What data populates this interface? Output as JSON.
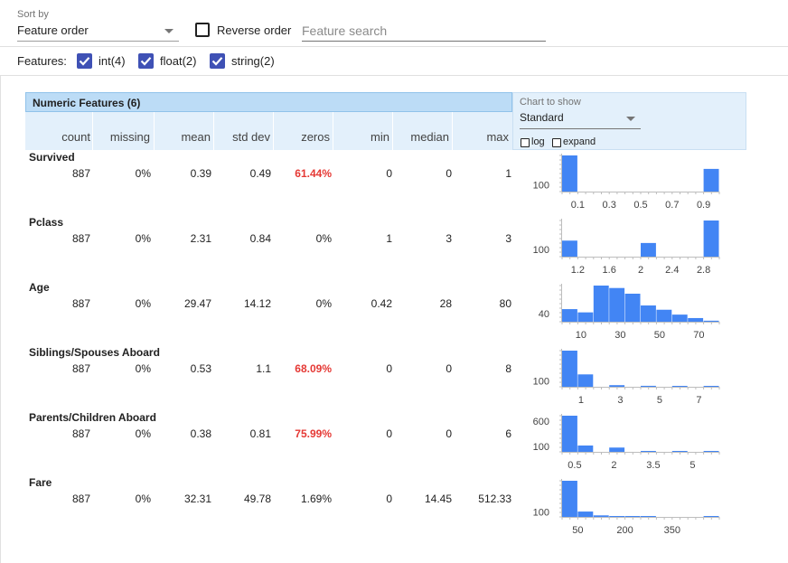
{
  "toolbar": {
    "sort_label": "Sort by",
    "sort_value": "Feature order",
    "reverse_label": "Reverse order",
    "reverse_checked": false,
    "search_placeholder": "Feature search"
  },
  "features_filter": {
    "label": "Features:",
    "items": [
      {
        "label": "int(4)",
        "checked": true
      },
      {
        "label": "float(2)",
        "checked": true
      },
      {
        "label": "string(2)",
        "checked": true
      }
    ]
  },
  "numeric_table": {
    "section_title": "Numeric Features (6)",
    "columns": [
      "count",
      "missing",
      "mean",
      "std dev",
      "zeros",
      "min",
      "median",
      "max"
    ],
    "chart_control": {
      "label": "Chart to show",
      "value": "Standard",
      "log_label": "log",
      "expand_label": "expand",
      "log_checked": false,
      "expand_checked": false
    },
    "rows": [
      {
        "name": "Survived",
        "count": "887",
        "missing": "0%",
        "mean": "0.39",
        "std_dev": "0.49",
        "zeros": "61.44%",
        "zeros_highlight": true,
        "min": "0",
        "median": "0",
        "max": "1"
      },
      {
        "name": "Pclass",
        "count": "887",
        "missing": "0%",
        "mean": "2.31",
        "std_dev": "0.84",
        "zeros": "0%",
        "zeros_highlight": false,
        "min": "1",
        "median": "3",
        "max": "3"
      },
      {
        "name": "Age",
        "count": "887",
        "missing": "0%",
        "mean": "29.47",
        "std_dev": "14.12",
        "zeros": "0%",
        "zeros_highlight": false,
        "min": "0.42",
        "median": "28",
        "max": "80"
      },
      {
        "name": "Siblings/Spouses Aboard",
        "count": "887",
        "missing": "0%",
        "mean": "0.53",
        "std_dev": "1.1",
        "zeros": "68.09%",
        "zeros_highlight": true,
        "min": "0",
        "median": "0",
        "max": "8"
      },
      {
        "name": "Parents/Children Aboard",
        "count": "887",
        "missing": "0%",
        "mean": "0.38",
        "std_dev": "0.81",
        "zeros": "75.99%",
        "zeros_highlight": true,
        "min": "0",
        "median": "0",
        "max": "6"
      },
      {
        "name": "Fare",
        "count": "887",
        "missing": "0%",
        "mean": "32.31",
        "std_dev": "49.78",
        "zeros": "1.69%",
        "zeros_highlight": false,
        "min": "0",
        "median": "14.45",
        "max": "512.33"
      }
    ]
  },
  "colors": {
    "bar": "#4285f4",
    "highlight": "#e53935",
    "checkbox": "#3f51b5",
    "header_bg": "#e3f0fb",
    "section_bg": "#bcdcf6"
  },
  "chart_data": [
    {
      "type": "bar",
      "feature": "Survived",
      "xlim": [
        0,
        1
      ],
      "x_ticks": [
        "0.1",
        "0.3",
        "0.5",
        "0.7",
        "0.9"
      ],
      "y_ticks": [
        "100"
      ],
      "values": [
        545,
        0,
        0,
        0,
        0,
        0,
        0,
        0,
        0,
        342
      ]
    },
    {
      "type": "bar",
      "feature": "Pclass",
      "xlim": [
        1,
        3
      ],
      "x_ticks": [
        "1.2",
        "1.6",
        "2",
        "2.4",
        "2.8"
      ],
      "y_ticks": [
        "100"
      ],
      "values": [
        216,
        0,
        0,
        0,
        0,
        184,
        0,
        0,
        0,
        487
      ]
    },
    {
      "type": "bar",
      "feature": "Age",
      "xlim": [
        0.42,
        80
      ],
      "x_ticks": [
        "10",
        "30",
        "50",
        "70"
      ],
      "y_ticks": [
        "40"
      ],
      "values": [
        62,
        46,
        178,
        166,
        138,
        80,
        59,
        35,
        18,
        5
      ]
    },
    {
      "type": "bar",
      "feature": "Siblings/Spouses Aboard",
      "xlim": [
        0,
        8
      ],
      "x_ticks": [
        "1",
        "3",
        "5",
        "7"
      ],
      "y_ticks": [
        "100"
      ],
      "values": [
        604,
        207,
        0,
        27,
        0,
        16,
        0,
        5,
        0,
        7
      ]
    },
    {
      "type": "bar",
      "feature": "Parents/Children Aboard",
      "xlim": [
        0,
        6
      ],
      "x_ticks": [
        "0.5",
        "2",
        "3.5",
        "5"
      ],
      "y_ticks": [
        "600",
        "100"
      ],
      "values": [
        674,
        118,
        0,
        80,
        0,
        5,
        0,
        4,
        0,
        6
      ]
    },
    {
      "type": "bar",
      "feature": "Fare",
      "xlim": [
        0,
        512.33
      ],
      "x_ticks": [
        "50",
        "200",
        "350"
      ],
      "y_ticks": [
        "100"
      ],
      "values": [
        728,
        108,
        31,
        2,
        11,
        6,
        0,
        0,
        0,
        3
      ]
    }
  ]
}
